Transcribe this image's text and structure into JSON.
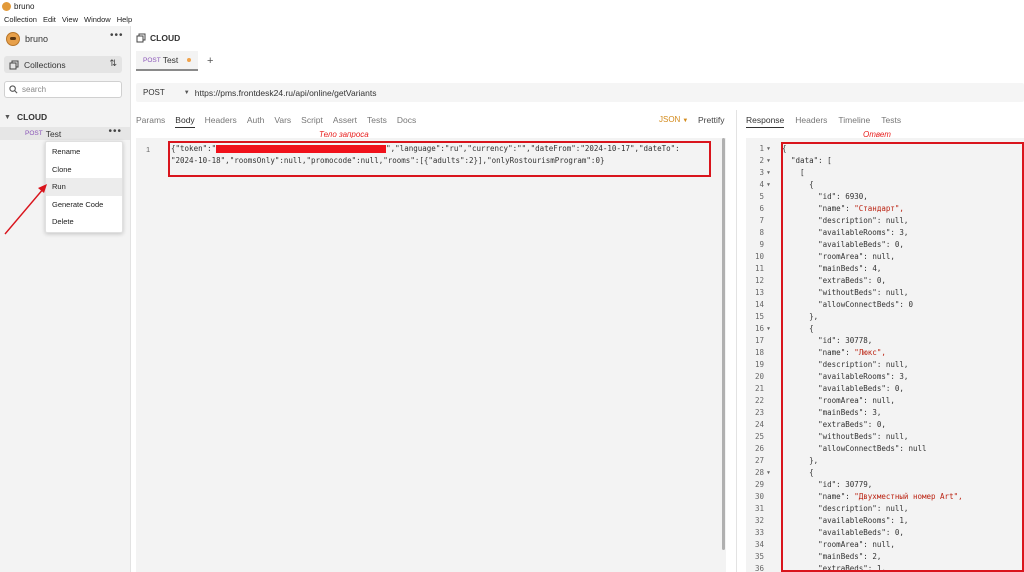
{
  "window": {
    "title": "bruno"
  },
  "menu": [
    "Collection",
    "Edit",
    "View",
    "Window",
    "Help"
  ],
  "sidebar": {
    "brand": "bruno",
    "collections_label": "Collections",
    "search_placeholder": "search",
    "collection_name": "CLOUD",
    "request": {
      "method": "POST",
      "name": "Test"
    }
  },
  "context_menu": [
    "Rename",
    "Clone",
    "Run",
    "Generate Code",
    "Delete"
  ],
  "header": {
    "collection_title": "CLOUD"
  },
  "tab": {
    "method": "POST",
    "name": "Test"
  },
  "url_bar": {
    "method": "POST",
    "url": "https://pms.frontdesk24.ru/api/online/getVariants"
  },
  "request_tabs": [
    "Params",
    "Body",
    "Headers",
    "Auth",
    "Vars",
    "Script",
    "Assert",
    "Tests",
    "Docs"
  ],
  "body_mode": "JSON",
  "prettify_label": "Prettify",
  "annotations": {
    "request_body": "Тело запроса",
    "response": "Ответ"
  },
  "request_body": {
    "line_number": "1",
    "line1_prefix": "{\"token\":\"",
    "line1_suffix": "\",\"language\":\"ru\",\"currency\":\"\",\"dateFrom\":\"2024-10-17\",\"dateTo\":",
    "line2": "\"2024-10-18\",\"roomsOnly\":null,\"promocode\":null,\"rooms\":[{\"adults\":2}],\"onlyRostourismProgram\":0}"
  },
  "response_tabs": [
    "Response",
    "Headers",
    "Timeline",
    "Tests"
  ],
  "response_lines": [
    {
      "n": "1",
      "fold": true,
      "t": "{"
    },
    {
      "n": "2",
      "fold": true,
      "t": "  \"data\": ["
    },
    {
      "n": "3",
      "fold": true,
      "t": "    ["
    },
    {
      "n": "4",
      "fold": true,
      "t": "      {"
    },
    {
      "n": "5",
      "k": "\"id\": ",
      "v": "6930,"
    },
    {
      "n": "6",
      "k": "\"name\": ",
      "v": "\"Стандарт\",",
      "str": true
    },
    {
      "n": "7",
      "k": "\"description\": ",
      "v": "null,"
    },
    {
      "n": "8",
      "k": "\"availableRooms\": ",
      "v": "3,"
    },
    {
      "n": "9",
      "k": "\"availableBeds\": ",
      "v": "0,"
    },
    {
      "n": "10",
      "k": "\"roomArea\": ",
      "v": "null,"
    },
    {
      "n": "11",
      "k": "\"mainBeds\": ",
      "v": "4,"
    },
    {
      "n": "12",
      "k": "\"extraBeds\": ",
      "v": "0,"
    },
    {
      "n": "13",
      "k": "\"withoutBeds\": ",
      "v": "null,"
    },
    {
      "n": "14",
      "k": "\"allowConnectBeds\": ",
      "v": "0"
    },
    {
      "n": "15",
      "t": "      },"
    },
    {
      "n": "16",
      "fold": true,
      "t": "      {"
    },
    {
      "n": "17",
      "k": "\"id\": ",
      "v": "30778,"
    },
    {
      "n": "18",
      "k": "\"name\": ",
      "v": "\"Люкс\",",
      "str": true
    },
    {
      "n": "19",
      "k": "\"description\": ",
      "v": "null,"
    },
    {
      "n": "20",
      "k": "\"availableRooms\": ",
      "v": "3,"
    },
    {
      "n": "21",
      "k": "\"availableBeds\": ",
      "v": "0,"
    },
    {
      "n": "22",
      "k": "\"roomArea\": ",
      "v": "null,"
    },
    {
      "n": "23",
      "k": "\"mainBeds\": ",
      "v": "3,"
    },
    {
      "n": "24",
      "k": "\"extraBeds\": ",
      "v": "0,"
    },
    {
      "n": "25",
      "k": "\"withoutBeds\": ",
      "v": "null,"
    },
    {
      "n": "26",
      "k": "\"allowConnectBeds\": ",
      "v": "null"
    },
    {
      "n": "27",
      "t": "      },"
    },
    {
      "n": "28",
      "fold": true,
      "t": "      {"
    },
    {
      "n": "29",
      "k": "\"id\": ",
      "v": "30779,"
    },
    {
      "n": "30",
      "k": "\"name\": ",
      "v": "\"Двухместный номер Art\",",
      "str": true
    },
    {
      "n": "31",
      "k": "\"description\": ",
      "v": "null,"
    },
    {
      "n": "32",
      "k": "\"availableRooms\": ",
      "v": "1,"
    },
    {
      "n": "33",
      "k": "\"availableBeds\": ",
      "v": "0,"
    },
    {
      "n": "34",
      "k": "\"roomArea\": ",
      "v": "null,"
    },
    {
      "n": "35",
      "k": "\"mainBeds\": ",
      "v": "2,"
    },
    {
      "n": "36",
      "k": "\"extraBeds\": ",
      "v": "1,"
    }
  ],
  "colors": {
    "accent": "#d38a1a",
    "method_post": "#8a55b8",
    "annotation_red": "#d9141c"
  }
}
